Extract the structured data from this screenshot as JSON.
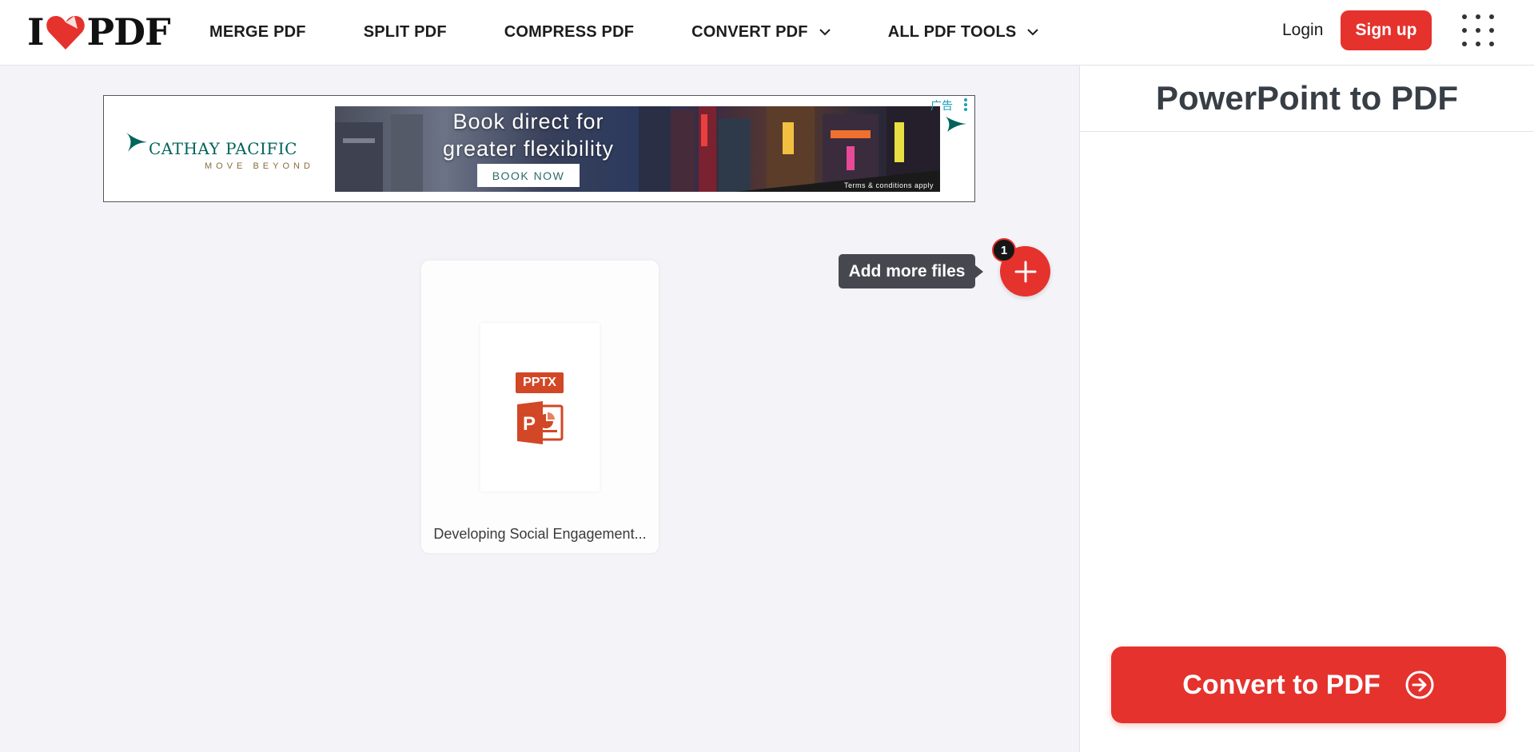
{
  "app": {
    "logo_left": "I",
    "logo_right": "PDF",
    "brand_color": "#e5322d"
  },
  "nav": {
    "items": [
      {
        "label": "MERGE PDF"
      },
      {
        "label": "SPLIT PDF"
      },
      {
        "label": "COMPRESS PDF"
      },
      {
        "label": "CONVERT PDF"
      },
      {
        "label": "ALL PDF TOOLS"
      }
    ],
    "login": "Login",
    "signup": "Sign up"
  },
  "ad": {
    "brand_name": "CATHAY PACIFIC",
    "brand_tagline": "MOVE BEYOND",
    "headline_line1": "Book direct for",
    "headline_line2": "greater flexibility",
    "cta": "BOOK NOW",
    "terms": "Terms & conditions apply",
    "ad_label": "广告"
  },
  "files": {
    "count": "1",
    "add_more": "Add more files",
    "items": [
      {
        "ext": "PPTX",
        "name": "Developing Social Engagement..."
      }
    ]
  },
  "sidebar": {
    "title": "PowerPoint to PDF",
    "convert": "Convert to PDF"
  }
}
